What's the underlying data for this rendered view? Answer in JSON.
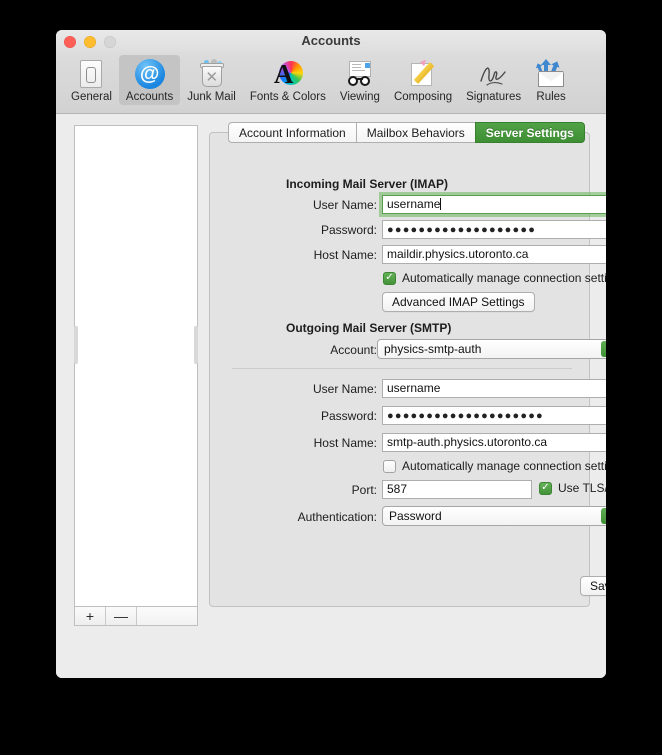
{
  "window": {
    "title": "Accounts",
    "traffic_lights": [
      "close-red",
      "minimize-yellow",
      "zoom-disabled"
    ]
  },
  "toolbar": {
    "items": [
      {
        "label": "General",
        "icon": "general-icon",
        "selected": false
      },
      {
        "label": "Accounts",
        "icon": "accounts-at-icon",
        "selected": true
      },
      {
        "label": "Junk Mail",
        "icon": "junk-mail-icon",
        "selected": false
      },
      {
        "label": "Fonts & Colors",
        "icon": "fonts-colors-icon",
        "selected": false
      },
      {
        "label": "Viewing",
        "icon": "viewing-icon",
        "selected": false
      },
      {
        "label": "Composing",
        "icon": "composing-icon",
        "selected": false
      },
      {
        "label": "Signatures",
        "icon": "signatures-icon",
        "selected": false
      },
      {
        "label": "Rules",
        "icon": "rules-icon",
        "selected": false
      }
    ]
  },
  "sidebar": {
    "accounts": [],
    "add_label": "+",
    "remove_label": "—"
  },
  "tabs": [
    {
      "label": "Account Information",
      "active": false
    },
    {
      "label": "Mailbox Behaviors",
      "active": false
    },
    {
      "label": "Server Settings",
      "active": true
    }
  ],
  "incoming": {
    "section_title": "Incoming Mail Server (IMAP)",
    "username_label": "User Name:",
    "username_value": "username",
    "password_label": "Password:",
    "password_value": "●●●●●●●●●●●●●●●●●●●",
    "hostname_label": "Host Name:",
    "hostname_value": "maildir.physics.utoronto.ca",
    "auto_manage_label": "Automatically manage connection settings",
    "auto_manage_checked": true,
    "advanced_button": "Advanced IMAP Settings"
  },
  "outgoing": {
    "section_title": "Outgoing Mail Server (SMTP)",
    "account_label": "Account:",
    "account_value": "physics-smtp-auth",
    "username_label": "User Name:",
    "username_value": "username",
    "password_label": "Password:",
    "password_value": "●●●●●●●●●●●●●●●●●●●●",
    "hostname_label": "Host Name:",
    "hostname_value": "smtp-auth.physics.utoronto.ca",
    "auto_manage_label": "Automatically manage connection settings",
    "auto_manage_checked": false,
    "port_label": "Port:",
    "port_value": "587",
    "tls_label": "Use TLS/SSL",
    "tls_checked": true,
    "auth_label": "Authentication:",
    "auth_value": "Password"
  },
  "footer": {
    "save_label": "Save",
    "help_label": "?"
  },
  "colors": {
    "accent_green": "#43933a",
    "tab_active_green": "#52a247",
    "window_bg": "#ececec",
    "panel_bg": "#e3e3e3"
  }
}
